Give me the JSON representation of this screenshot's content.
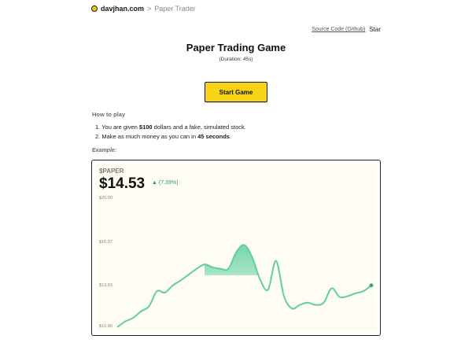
{
  "breadcrumb": {
    "home": "davjhan.com",
    "separator": ">",
    "current": "Paper Trader"
  },
  "toplinks": {
    "source": "Source Code (Github)",
    "star": "Star"
  },
  "header": {
    "title": "Paper Trading Game",
    "duration": "(Duration: 45s)"
  },
  "start_button": {
    "label": "Start Game"
  },
  "howto": {
    "title": "How to play",
    "step1_num": "1.",
    "step1_a": "You are given ",
    "step1_b": "$100",
    "step1_c": " dollars and a fake, simulated stock.",
    "step2_num": "2.",
    "step2_a": "Make as much money as you can in ",
    "step2_b": "45 seconds",
    "step2_c": "."
  },
  "example": {
    "label": "Example:"
  },
  "chart": {
    "ticker": "$PAPER",
    "price": "$14.53",
    "change_arrow": "▲",
    "change": "(7.39%)",
    "line_color": "#5fcf9f",
    "ylabels": [
      "$20.00",
      "$16.97",
      "$13.53",
      "$10.90"
    ]
  },
  "chart_data": {
    "type": "line",
    "title": "$PAPER",
    "ylabel": "",
    "xlabel": "",
    "yticks": [
      "$20.00",
      "$16.97",
      "$13.53",
      "$10.90"
    ],
    "ylim": [
      10.9,
      20.0
    ],
    "y": [
      10.9,
      11.3,
      11.55,
      12.0,
      12.35,
      13.4,
      13.3,
      13.8,
      14.15,
      14.55,
      14.95,
      15.25,
      15.05,
      14.95,
      14.95,
      16.1,
      16.6,
      15.75,
      14.2,
      13.5,
      15.5,
      13.05,
      12.2,
      12.45,
      12.6,
      12.45,
      12.6,
      13.6,
      13.0,
      13.05,
      13.25,
      13.4,
      13.8
    ]
  }
}
